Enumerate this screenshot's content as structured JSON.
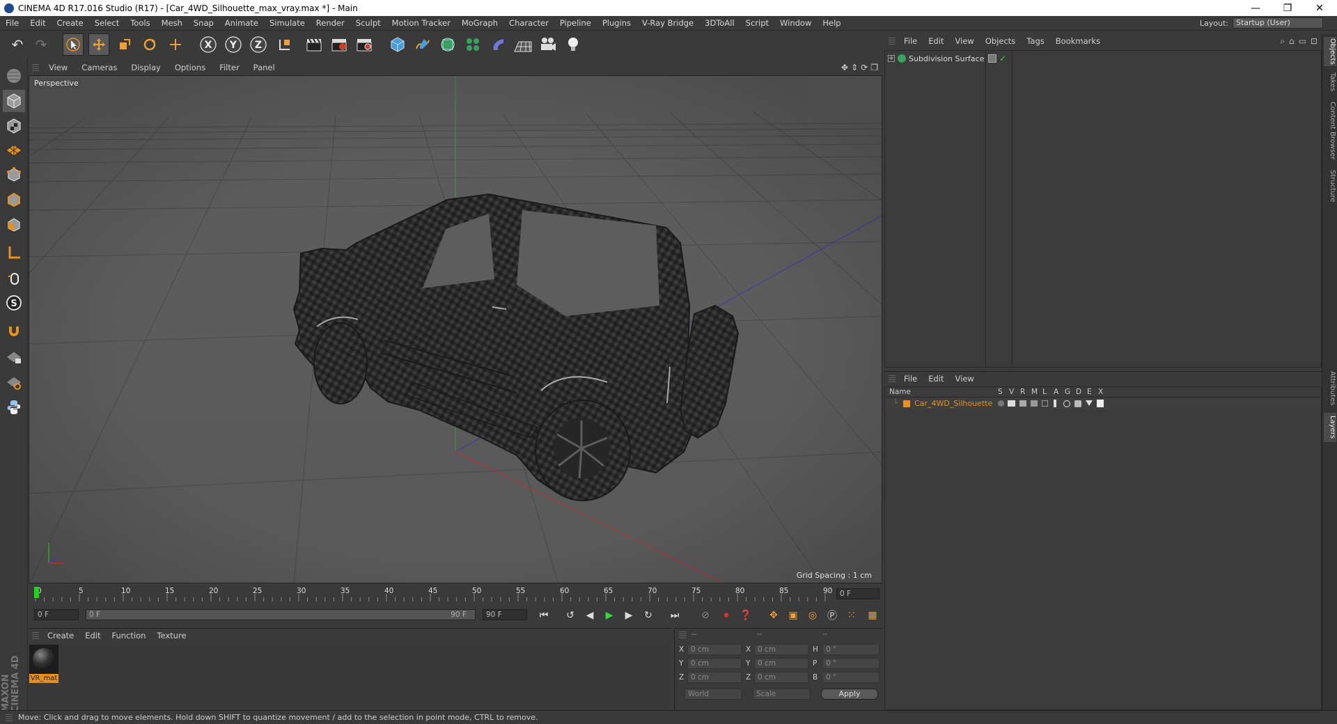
{
  "titlebar": {
    "title": "CINEMA 4D R17.016 Studio (R17) - [Car_4WD_Silhouette_max_vray.max *] - Main",
    "minimize": "—",
    "restore": "❐",
    "close": "✕"
  },
  "menubar": {
    "items": [
      "File",
      "Edit",
      "Create",
      "Select",
      "Tools",
      "Mesh",
      "Snap",
      "Animate",
      "Simulate",
      "Render",
      "Sculpt",
      "Motion Tracker",
      "MoGraph",
      "Character",
      "Pipeline",
      "Plugins",
      "V-Ray Bridge",
      "3DToAll",
      "Script",
      "Window",
      "Help"
    ],
    "layout_label": "Layout:",
    "layout_value": "Startup (User)"
  },
  "viewport": {
    "menu": [
      "View",
      "Cameras",
      "Display",
      "Options",
      "Filter",
      "Panel"
    ],
    "label": "Perspective",
    "grid_spacing": "Grid Spacing : 1 cm"
  },
  "timeline": {
    "ticks": [
      "0",
      "5",
      "10",
      "15",
      "20",
      "25",
      "30",
      "35",
      "40",
      "45",
      "50",
      "55",
      "60",
      "65",
      "70",
      "75",
      "80",
      "85",
      "90"
    ],
    "end_field": "0 F",
    "start_frame": "0 F",
    "range_start": "0 F",
    "range_end": "90 F",
    "max_frame": "90 F"
  },
  "material_manager": {
    "menu": [
      "Create",
      "Edit",
      "Function",
      "Texture"
    ],
    "material_name": "VR_mat"
  },
  "coordinates": {
    "headers": [
      "--",
      "--",
      "--"
    ],
    "rows": [
      {
        "l1": "X",
        "v1": "0 cm",
        "l2": "X",
        "v2": "0 cm",
        "l3": "H",
        "v3": "0 °"
      },
      {
        "l1": "Y",
        "v1": "0 cm",
        "l2": "Y",
        "v2": "0 cm",
        "l3": "P",
        "v3": "0 °"
      },
      {
        "l1": "Z",
        "v1": "0 cm",
        "l2": "Z",
        "v2": "0 cm",
        "l3": "B",
        "v3": "0 °"
      }
    ],
    "mode1": "World",
    "mode2": "Scale",
    "apply": "Apply"
  },
  "object_manager": {
    "menu": [
      "File",
      "Edit",
      "View",
      "Objects",
      "Tags",
      "Bookmarks"
    ],
    "object_name": "Subdivision Surface"
  },
  "layer_manager": {
    "menu": [
      "File",
      "Edit",
      "View"
    ],
    "columns": [
      "Name",
      "S",
      "V",
      "R",
      "M",
      "L",
      "A",
      "G",
      "D",
      "E",
      "X"
    ],
    "layer_name": "Car_4WD_Silhouette"
  },
  "side_tabs": [
    "Objects",
    "Takes",
    "Content Browser",
    "Structure",
    "Attributes",
    "Layers"
  ],
  "status": {
    "text": "Move: Click and drag to move elements. Hold down SHIFT to quantize movement / add to the selection in point mode, CTRL to remove."
  },
  "brand": "MAXON CINEMA 4D",
  "colors": {
    "accent_orange": "#e8901c",
    "bg": "#3b3b3b",
    "viewport": "#5a5a5a"
  }
}
